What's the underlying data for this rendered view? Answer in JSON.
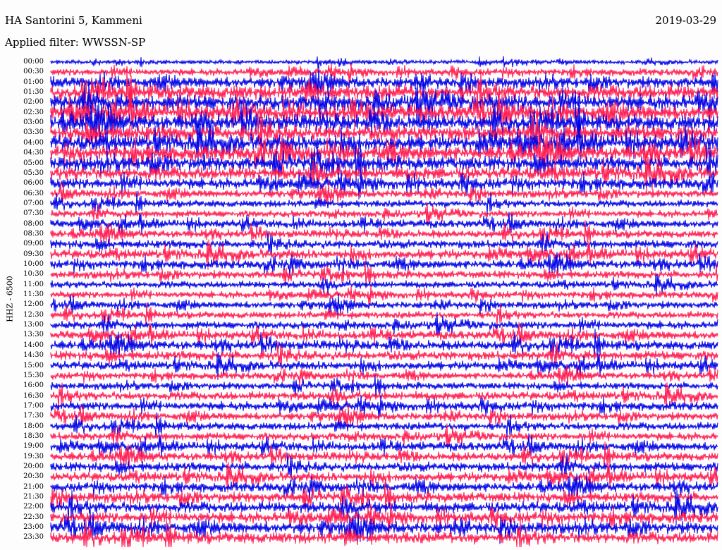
{
  "header": {
    "station": "HA Santorini 5, Kammeni",
    "date": "2019-03-29",
    "filter": "Applied filter: WWSSN-SP"
  },
  "channel_label": "HHZ - 6500",
  "colors": {
    "odd_line": "#0000e6",
    "even_line": "#ff1a4f",
    "background": "#fdfdfd"
  },
  "chart_data": {
    "type": "line",
    "title": "HA Santorini 5, Kammeni",
    "subtitle": "Applied filter: WWSSN-SP",
    "ylabel": "HHZ - 6500",
    "xlabel": "",
    "rows": [
      "00:00",
      "00:30",
      "01:00",
      "01:30",
      "02:00",
      "02:30",
      "03:00",
      "03:30",
      "04:00",
      "04:30",
      "05:00",
      "05:30",
      "06:00",
      "06:30",
      "07:00",
      "07:30",
      "08:00",
      "08:30",
      "09:00",
      "09:30",
      "10:00",
      "10:30",
      "11:00",
      "11:30",
      "12:00",
      "12:30",
      "13:00",
      "13:30",
      "14:00",
      "14:30",
      "15:00",
      "15:30",
      "16:00",
      "16:30",
      "17:00",
      "17:30",
      "18:00",
      "18:30",
      "19:00",
      "19:30",
      "20:00",
      "20:30",
      "21:00",
      "21:30",
      "22:00",
      "22:30",
      "23:00",
      "23:30"
    ],
    "row_colors": [
      "blue",
      "red"
    ],
    "relative_amplitude": [
      0.25,
      0.45,
      0.7,
      0.95,
      1.0,
      1.0,
      1.0,
      1.0,
      1.0,
      0.95,
      0.9,
      0.85,
      0.7,
      0.5,
      0.45,
      0.45,
      0.5,
      0.5,
      0.55,
      0.6,
      0.55,
      0.5,
      0.45,
      0.45,
      0.45,
      0.45,
      0.5,
      0.55,
      0.6,
      0.6,
      0.55,
      0.45,
      0.45,
      0.55,
      0.55,
      0.5,
      0.5,
      0.5,
      0.55,
      0.55,
      0.6,
      0.6,
      0.6,
      0.65,
      0.7,
      0.7,
      0.75,
      0.75
    ],
    "grid": false
  }
}
